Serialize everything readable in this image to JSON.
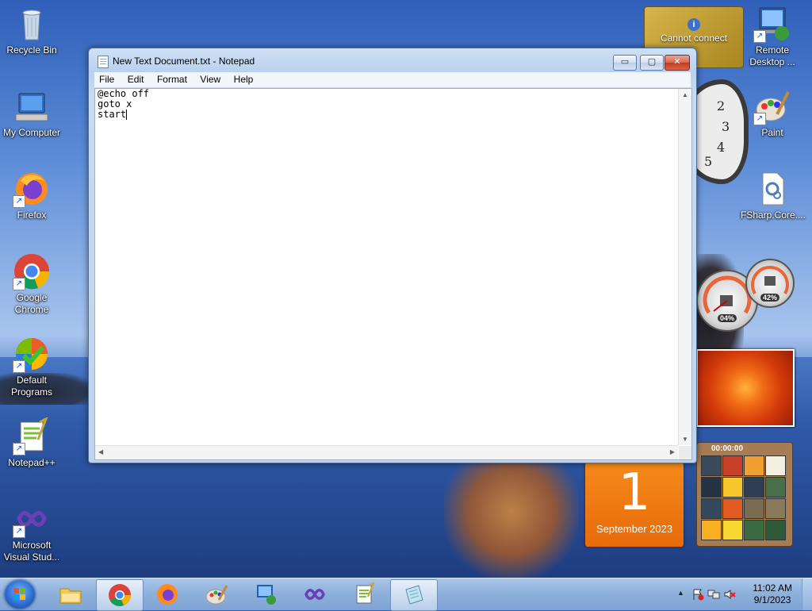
{
  "desktop": {
    "icons_left": [
      {
        "label": "Recycle Bin",
        "icon": "recycle-bin-icon"
      },
      {
        "label": "My Computer",
        "icon": "computer-icon"
      },
      {
        "label": "Firefox",
        "icon": "firefox-icon"
      },
      {
        "label": "Google Chrome",
        "icon": "chrome-icon"
      },
      {
        "label": "Default Programs",
        "icon": "default-programs-icon"
      },
      {
        "label": "Notepad++",
        "icon": "notepadpp-icon"
      },
      {
        "label": "Microsoft Visual Stud...",
        "icon": "visual-studio-icon"
      }
    ],
    "icons_right": [
      {
        "label": "Remote Desktop ...",
        "icon": "remote-desktop-icon"
      },
      {
        "label": "Paint",
        "icon": "paint-icon"
      },
      {
        "label": "FSharp.Core....",
        "icon": "config-file-icon"
      }
    ]
  },
  "gadgets": {
    "warning_text": "Cannot connect",
    "clock_numbers": [
      "2",
      "3",
      "4",
      "5"
    ],
    "cpu_percent": "04%",
    "memory_percent": "42%",
    "calendar_day": "1",
    "calendar_month": "September 2023",
    "puzzle_timer": "00:00:00"
  },
  "notepad": {
    "title": "New Text Document.txt - Notepad",
    "menu": [
      "File",
      "Edit",
      "Format",
      "View",
      "Help"
    ],
    "lines": [
      "@echo off",
      "goto x",
      "start"
    ],
    "buttons": {
      "minimize": "▭",
      "maximize": "▢",
      "close": "✕"
    }
  },
  "taskbar": {
    "apps": [
      {
        "name": "File Explorer",
        "icon": "folder-icon"
      },
      {
        "name": "Google Chrome",
        "icon": "chrome-icon"
      },
      {
        "name": "Firefox",
        "icon": "firefox-icon"
      },
      {
        "name": "Paint",
        "icon": "paint-icon"
      },
      {
        "name": "Remote Desktop",
        "icon": "remote-desktop-icon"
      },
      {
        "name": "Visual Studio",
        "icon": "visual-studio-icon"
      },
      {
        "name": "Notepad++",
        "icon": "notepadpp-icon"
      },
      {
        "name": "Notepad",
        "icon": "notepad-icon"
      }
    ],
    "time": "11:02 AM",
    "date": "9/1/2023"
  }
}
